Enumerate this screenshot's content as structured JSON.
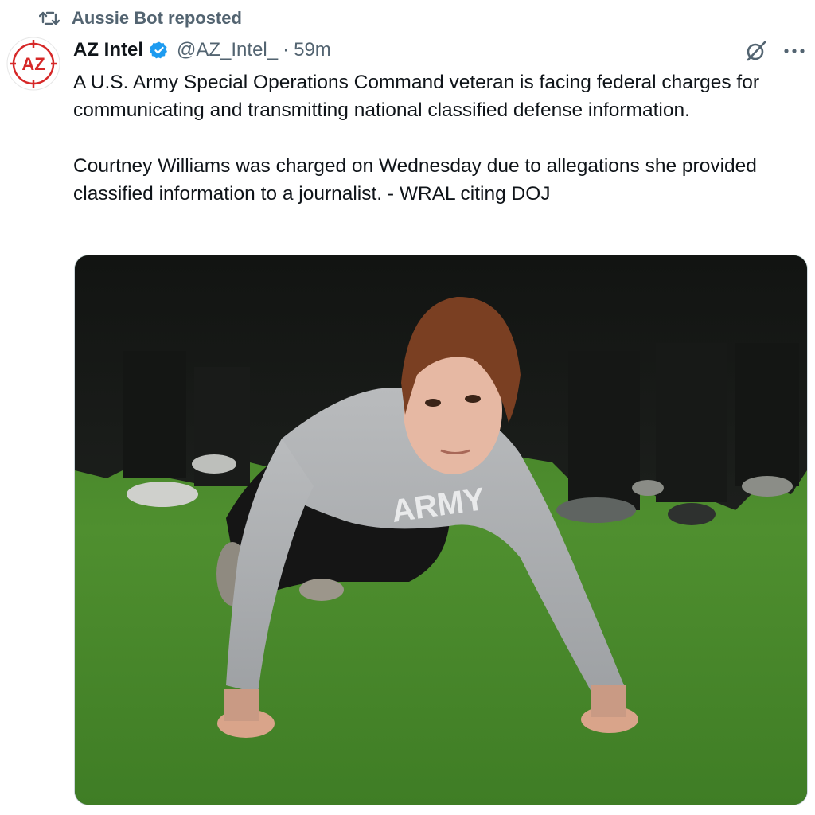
{
  "repost": {
    "icon": "repost-icon",
    "label": "Aussie Bot reposted"
  },
  "author": {
    "avatar_text": "AZ",
    "display_name": "AZ Intel",
    "verified_icon": "verified-badge-icon",
    "handle": "@AZ_Intel_",
    "separator": "·",
    "time": "59m"
  },
  "actions": {
    "grok_icon": "grok-icon",
    "more_icon": "more-options-icon"
  },
  "tweet": {
    "paragraph_1": "A U.S. Army Special Operations Command veteran is facing federal charges for communicating and transmitting national classified defense information.",
    "paragraph_2": "Courtney Williams was charged on Wednesday due to allegations she provided classified information to a journalist. - WRAL citing DOJ"
  },
  "media": {
    "shirt_text": "ARMY"
  },
  "colors": {
    "text_primary": "#0f1419",
    "text_secondary": "#536471",
    "verified_blue": "#1d9bf0",
    "avatar_red": "#d62828",
    "grass_green": "#4f8a2e"
  }
}
